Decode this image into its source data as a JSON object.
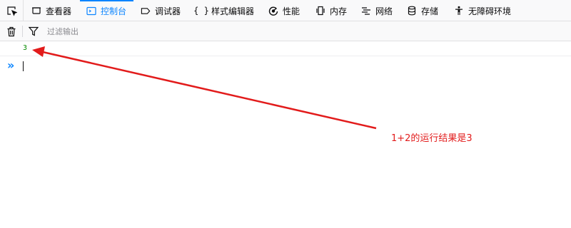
{
  "toolbar": {
    "tabs": [
      {
        "label": "查看器",
        "icon": "inspector-icon",
        "selected": false
      },
      {
        "label": "控制台",
        "icon": "console-icon",
        "selected": true
      },
      {
        "label": "调试器",
        "icon": "debugger-icon",
        "selected": false
      },
      {
        "label": "样式编辑器",
        "icon": "style-editor-icon",
        "selected": false
      },
      {
        "label": "性能",
        "icon": "performance-icon",
        "selected": false
      },
      {
        "label": "内存",
        "icon": "memory-icon",
        "selected": false
      },
      {
        "label": "网络",
        "icon": "network-icon",
        "selected": false
      },
      {
        "label": "存储",
        "icon": "storage-icon",
        "selected": false
      },
      {
        "label": "无障碍环境",
        "icon": "accessibility-icon",
        "selected": false
      }
    ],
    "accent_color": "#0a84ff"
  },
  "filterbar": {
    "placeholder": "过滤输出"
  },
  "console": {
    "output_value": "3",
    "prompt_symbol": "»",
    "result_color": "#058b00"
  },
  "annotation": {
    "text": "1+2的运行结果是3",
    "color": "#e21b1b"
  }
}
